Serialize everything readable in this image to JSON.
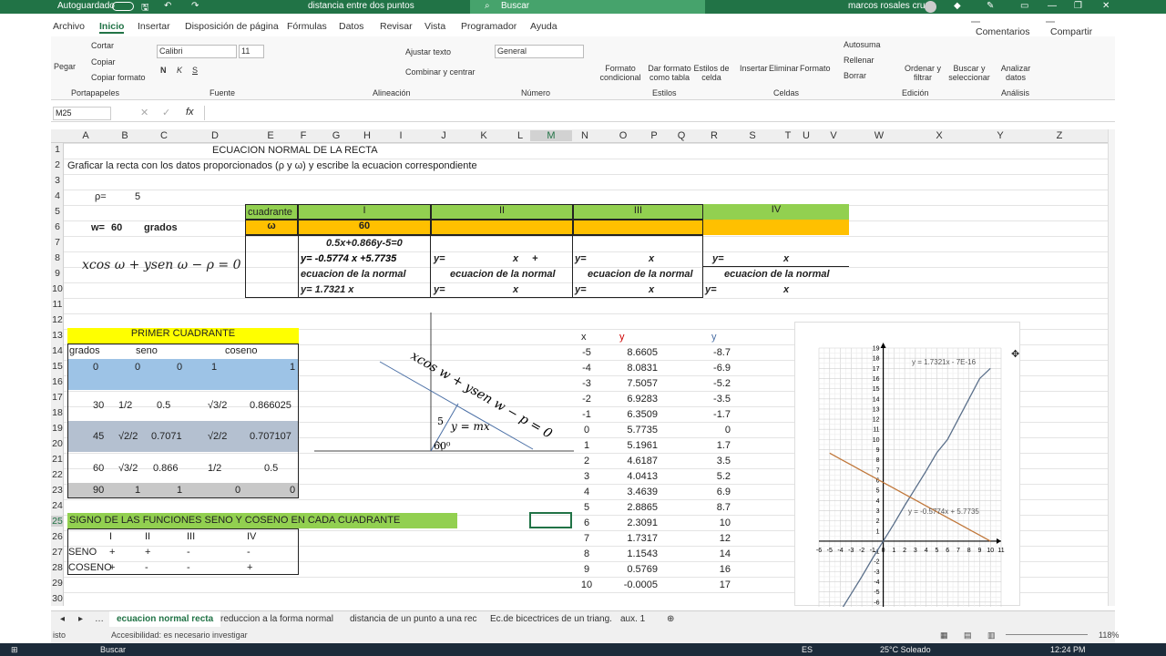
{
  "titlebar": {
    "autosave": "Autoguardado",
    "filename": "distancia entre dos puntos",
    "search": "Buscar",
    "user": "marcos rosales cruz"
  },
  "ribbon_tabs": [
    "Archivo",
    "Inicio",
    "Insertar",
    "Disposición de página",
    "Fórmulas",
    "Datos",
    "Revisar",
    "Vista",
    "Programador",
    "Ayuda"
  ],
  "comments_btn": "Comentarios",
  "share_btn": "Compartir",
  "ribbon": {
    "pegar": "Pegar",
    "cortar": "Cortar",
    "copiar": "Copiar",
    "copiar_formato": "Copiar formato",
    "portapapeles": "Portapapeles",
    "font_name": "Calibri",
    "font_size": "11",
    "fuente": "Fuente",
    "ajustar": "Ajustar texto",
    "combinar": "Combinar y centrar",
    "alineacion": "Alineación",
    "numfmt": "General",
    "numero": "Número",
    "formato_cond": "Formato condicional",
    "dar_formato": "Dar formato como tabla",
    "estilos_celda": "Estilos de celda",
    "estilos": "Estilos",
    "insertar": "Insertar",
    "eliminar": "Eliminar",
    "formato": "Formato",
    "celdas": "Celdas",
    "autosuma": "Autosuma",
    "rellenar": "Rellenar",
    "borrar": "Borrar",
    "ordenar": "Ordenar y filtrar",
    "buscar_sel": "Buscar y seleccionar",
    "edicion": "Edición",
    "analizar": "Analizar datos",
    "analisis": "Análisis"
  },
  "namebox": "M25",
  "columns": [
    "A",
    "B",
    "C",
    "D",
    "E",
    "F",
    "G",
    "H",
    "I",
    "J",
    "K",
    "L",
    "M",
    "N",
    "O",
    "P",
    "Q",
    "R",
    "S",
    "T",
    "U",
    "V",
    "W",
    "X",
    "Y",
    "Z"
  ],
  "rows": [
    "1",
    "2",
    "3",
    "4",
    "5",
    "6",
    "7",
    "8",
    "9",
    "10",
    "11",
    "12",
    "13",
    "14",
    "15",
    "16",
    "17",
    "18",
    "19",
    "20",
    "21",
    "22",
    "23",
    "24",
    "25",
    "26",
    "27",
    "28",
    "29",
    "30"
  ],
  "sheet": {
    "title": "ECUACION NORMAL DE LA RECTA",
    "subtitle": "Graficar la recta con los datos proporcionados (ρ y  ω)  y escribe la ecuacion correspondiente",
    "rho_label": "ρ=",
    "rho_val": "5",
    "w_label": "w=",
    "w_val": "60",
    "grados": "grados",
    "formula": "xcos ω + ysen ω − ρ = 0",
    "cuadrante": "cuadrante",
    "omega": "ω",
    "q1": "I",
    "q2": "II",
    "q3": "III",
    "q4": "IV",
    "omega_val": "60",
    "eq_general": "0.5x+0.866y-5=0",
    "y_eq": "y=  -0.5774   x  +5.7735",
    "y_eq_blank": "y=",
    "x_mark": "x",
    "plus": "+",
    "ecuacion_normal": "ecuacion de la normal",
    "ecuacion_normal_2": "ecuacion de la  normal",
    "y_normal": "y=    1.7321   x",
    "primer_cuadrante": "PRIMER CUADRANTE",
    "th_grados": "grados",
    "th_seno": "seno",
    "th_coseno": "coseno",
    "trig_rows": [
      [
        "0",
        "0",
        "0",
        "1",
        "1"
      ],
      [
        "30",
        "1/2",
        "0.5",
        "√3/2",
        "0.866025"
      ],
      [
        "45",
        "√2/2",
        "0.7071",
        "√2/2",
        "0.707107"
      ],
      [
        "60",
        "√3/2",
        "0.866",
        "1/2",
        "0.5"
      ],
      [
        "90",
        "1",
        "1",
        "0",
        "0"
      ]
    ],
    "signo_title": "SIGNO DE LAS FUNCIONES SENO Y COSENO EN CADA CUADRANTE",
    "signo_hdr": [
      "I",
      "II",
      "III",
      "IV"
    ],
    "seno_lbl": "SENO",
    "seno": [
      "+",
      "+",
      "-",
      "-"
    ],
    "coseno_lbl": "COSENO",
    "coseno": [
      "+",
      "-",
      "-",
      "+"
    ],
    "diag_formula": "xcos w + ysen w − p = 0",
    "diag_five": "5",
    "diag_ymx": "y = mx",
    "diag_angle": "60⁰",
    "tbl_x": "x",
    "tbl_y": "y",
    "tbl_y2": "y",
    "table": [
      [
        "-5",
        "8.6605",
        "-8.7"
      ],
      [
        "-4",
        "8.0831",
        "-6.9"
      ],
      [
        "-3",
        "7.5057",
        "-5.2"
      ],
      [
        "-2",
        "6.9283",
        "-3.5"
      ],
      [
        "-1",
        "6.3509",
        "-1.7"
      ],
      [
        "0",
        "5.7735",
        "0"
      ],
      [
        "1",
        "5.1961",
        "1.7"
      ],
      [
        "2",
        "4.6187",
        "3.5"
      ],
      [
        "3",
        "4.0413",
        "5.2"
      ],
      [
        "4",
        "3.4639",
        "6.9"
      ],
      [
        "5",
        "2.8865",
        "8.7"
      ],
      [
        "6",
        "2.3091",
        "10"
      ],
      [
        "7",
        "1.7317",
        "12"
      ],
      [
        "8",
        "1.1543",
        "14"
      ],
      [
        "9",
        "0.5769",
        "16"
      ],
      [
        "10",
        "-0.0005",
        "17"
      ]
    ]
  },
  "chart_data": {
    "type": "scatter",
    "series": [
      {
        "name": "y = 1.7321x - 7E-16",
        "x": [
          -5,
          -4,
          -3,
          -2,
          -1,
          0,
          1,
          2,
          3,
          4,
          5,
          6,
          7,
          8,
          9,
          10
        ],
        "y": [
          -8.7,
          -6.9,
          -5.2,
          -3.5,
          -1.7,
          0,
          1.7,
          3.5,
          5.2,
          6.9,
          8.7,
          10,
          12,
          14,
          16,
          17
        ],
        "color": "#5a6f8a"
      },
      {
        "name": "y = -0.5774x + 5.7735",
        "x": [
          -5,
          -4,
          -3,
          -2,
          -1,
          0,
          1,
          2,
          3,
          4,
          5,
          6,
          7,
          8,
          9,
          10
        ],
        "y": [
          8.6605,
          8.0831,
          7.5057,
          6.9283,
          6.3509,
          5.7735,
          5.1961,
          4.6187,
          4.0413,
          3.4639,
          2.8865,
          2.3091,
          1.7317,
          1.1543,
          0.5769,
          -0.0005
        ],
        "color": "#c0773a"
      }
    ],
    "xlim": [
      -6,
      11
    ],
    "ylim": [
      -7,
      19
    ],
    "xticks": [
      "-6",
      "-5",
      "-4",
      "-3",
      "-2",
      "-1",
      "0",
      "1",
      "2",
      "3",
      "4",
      "5",
      "6",
      "7",
      "8",
      "9",
      "10",
      "11"
    ],
    "yticks": [
      "19",
      "18",
      "17",
      "16",
      "15",
      "14",
      "13",
      "12",
      "11",
      "10",
      "9",
      "8",
      "7",
      "6",
      "5",
      "4",
      "3",
      "2",
      "1",
      "0",
      "-1",
      "-2",
      "-3",
      "-4",
      "-5",
      "-6",
      "-7"
    ],
    "grid": true
  },
  "sheet_tabs": [
    "ecuacion normal recta",
    "reduccion a la forma normal",
    "distancia de un punto a una rec",
    "Ec.de bicectrices de un triang.",
    "aux. 1"
  ],
  "status": {
    "left": "isto",
    "accesibilidad": "Accesibilidad: es necesario investigar",
    "zoom": "118%"
  },
  "taskbar": {
    "search": "Buscar",
    "weather": "25°C  Soleado",
    "time": "12:24 PM",
    "lang": "ES"
  }
}
